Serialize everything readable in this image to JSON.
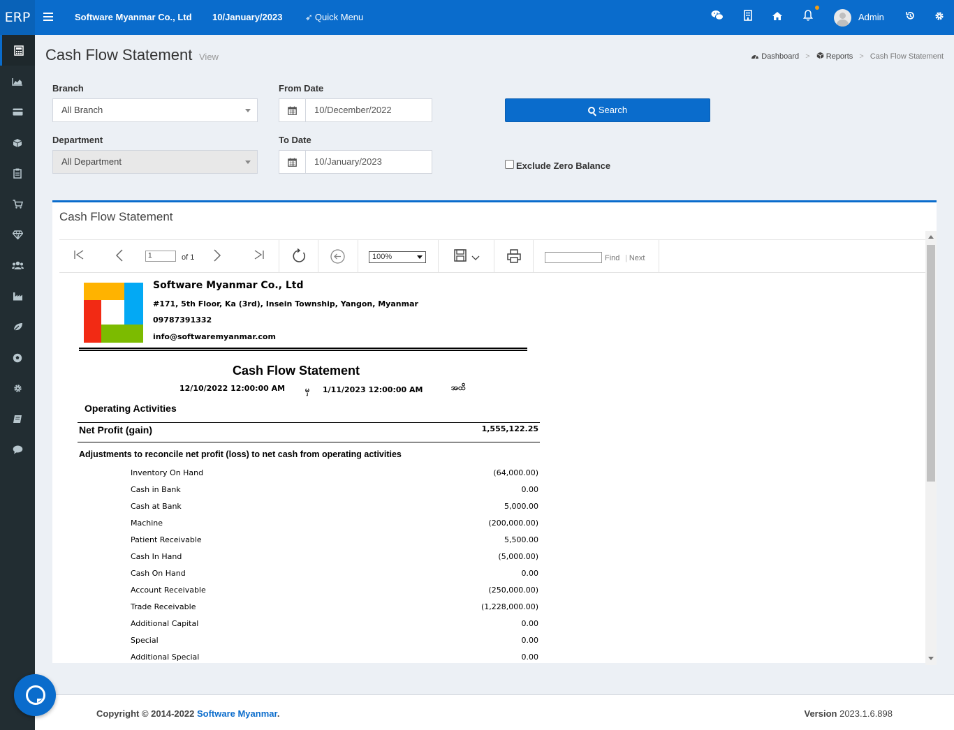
{
  "topbar": {
    "logo": "ERP",
    "company": "Software Myanmar Co., Ltd",
    "date": "10/January/2023",
    "quick_menu": "Quick Menu",
    "user": "Admin",
    "icons": [
      "wechat-icon",
      "building-icon",
      "home-icon",
      "bell-icon",
      "history-icon",
      "gear-icon"
    ]
  },
  "sidebar": {
    "icons": [
      "calculator-icon",
      "area-chart-icon",
      "credit-card-icon",
      "cube-icon",
      "clipboard-icon",
      "cart-icon",
      "diamond-icon",
      "users-icon",
      "industry-icon",
      "leaf-icon",
      "soccer-ball-icon",
      "gear-icon",
      "book-icon",
      "comment-icon"
    ]
  },
  "header": {
    "title": "Cash Flow Statement",
    "subtitle": "View",
    "breadcrumb": [
      "Dashboard",
      "Reports",
      "Cash Flow Statement"
    ]
  },
  "filters": {
    "branch_label": "Branch",
    "branch_value": "All Branch",
    "department_label": "Department",
    "department_value": "All Department",
    "from_label": "From Date",
    "from_value": "10/December/2022",
    "to_label": "To Date",
    "to_value": "10/January/2023",
    "search_label": "Search",
    "exclude_label": "Exclude Zero Balance"
  },
  "box": {
    "title": "Cash Flow Statement"
  },
  "viewer": {
    "page_value": "1",
    "page_of": "of 1",
    "zoom": "100%",
    "find": "Find",
    "next": "Next"
  },
  "report": {
    "company": "Software Myanmar Co., Ltd",
    "address": "#171, 5th Floor, Ka (3rd), Insein Township, Yangon, Myanmar",
    "phone": "09787391332",
    "email": "info@softwaremyanmar.com",
    "title": "Cash Flow  Statement",
    "date_from": "12/10/2022 12:00:00 AM",
    "mm_from": "မှ",
    "date_to": "1/11/2023 12:00:00 AM",
    "mm_to": "အထိ",
    "operating": "Operating Activities",
    "net_profit_label": "Net Profit (gain)",
    "net_profit_value": "1,555,122.25",
    "adjustments": "Adjustments to reconcile net profit (loss) to net cash from operating activities",
    "rows": [
      {
        "name": "Inventory On Hand",
        "amount": "(64,000.00)"
      },
      {
        "name": "Cash in Bank",
        "amount": "0.00"
      },
      {
        "name": "Cash at Bank",
        "amount": "5,000.00"
      },
      {
        "name": "Machine",
        "amount": "(200,000.00)"
      },
      {
        "name": "Patient Receivable",
        "amount": "5,500.00"
      },
      {
        "name": "Cash In Hand",
        "amount": "(5,000.00)"
      },
      {
        "name": "Cash On Hand",
        "amount": "0.00"
      },
      {
        "name": "Account Receivable",
        "amount": "(250,000.00)"
      },
      {
        "name": "Trade Receivable",
        "amount": "(1,228,000.00)"
      },
      {
        "name": "Additional Capital",
        "amount": "0.00"
      },
      {
        "name": "Special",
        "amount": "0.00"
      },
      {
        "name": "Additional Special",
        "amount": "0.00"
      }
    ]
  },
  "footer": {
    "copyright_prefix": "Copyright © 2014-2022 ",
    "copyright_link": "Software Myanmar",
    "copyright_suffix": ".",
    "version_label": "Version",
    "version_value": "2023.1.6.898"
  },
  "colors": {
    "primary": "#0a6ccc",
    "sidebar": "#222d32",
    "background": "#ecf0f5"
  }
}
